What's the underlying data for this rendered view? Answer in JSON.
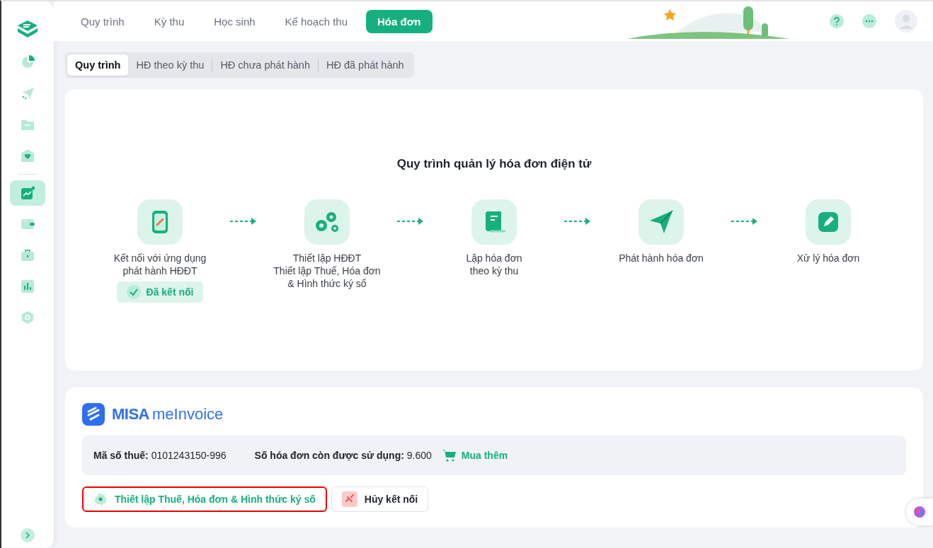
{
  "sidebar": {
    "groups": [
      [
        {
          "selected": false
        },
        {
          "selected": false
        },
        {
          "selected": false
        },
        {
          "selected": false
        }
      ],
      [
        {
          "selected": true
        },
        {
          "selected": false
        },
        {
          "selected": false
        },
        {
          "selected": false
        },
        {
          "selected": false
        }
      ]
    ]
  },
  "top_tabs": [
    {
      "label": "Quy trình",
      "selected": false
    },
    {
      "label": "Kỳ thu",
      "selected": false
    },
    {
      "label": "Học sinh",
      "selected": false
    },
    {
      "label": "Kế hoạch thu",
      "selected": false
    },
    {
      "label": "Hóa đơn",
      "selected": true
    }
  ],
  "sub_tabs": [
    {
      "label": "Quy trình",
      "selected": true
    },
    {
      "label": "HĐ theo kỳ thu",
      "selected": false
    },
    {
      "label": "HĐ chưa phát hành",
      "selected": false
    },
    {
      "label": "HĐ đã phát hành",
      "selected": false
    }
  ],
  "process": {
    "title": "Quy trình quản lý hóa đơn điện tử",
    "steps": [
      {
        "lines": [
          "Kết nối với ứng dụng",
          "phát hành HĐĐT"
        ],
        "status": "Đã kết nối"
      },
      {
        "lines": [
          "Thiết lập HĐĐT",
          "Thiết lập Thuế, Hóa đơn",
          "& Hình thức ký số"
        ]
      },
      {
        "lines": [
          "Lập hóa đơn",
          "theo kỳ thu"
        ]
      },
      {
        "lines": [
          "Phát hành hóa đơn"
        ]
      },
      {
        "lines": [
          "Xử lý hóa đơn"
        ]
      }
    ]
  },
  "provider": {
    "logo": {
      "brand": "MISA",
      "product": "meInvoice"
    },
    "info": [
      {
        "label": "Mã số thuế:",
        "value": "0101243150-996"
      },
      {
        "label": "Số hóa đơn còn được sử dụng:",
        "value": "9.600"
      }
    ],
    "buy_link": "Mua thêm",
    "buttons": [
      {
        "kind": "settings",
        "label": "Thiết lập Thuế, Hóa đơn & Hình thức ký số",
        "highlighted": true
      },
      {
        "kind": "disconnect",
        "label": "Hủy kết nối",
        "highlighted": false
      }
    ]
  }
}
